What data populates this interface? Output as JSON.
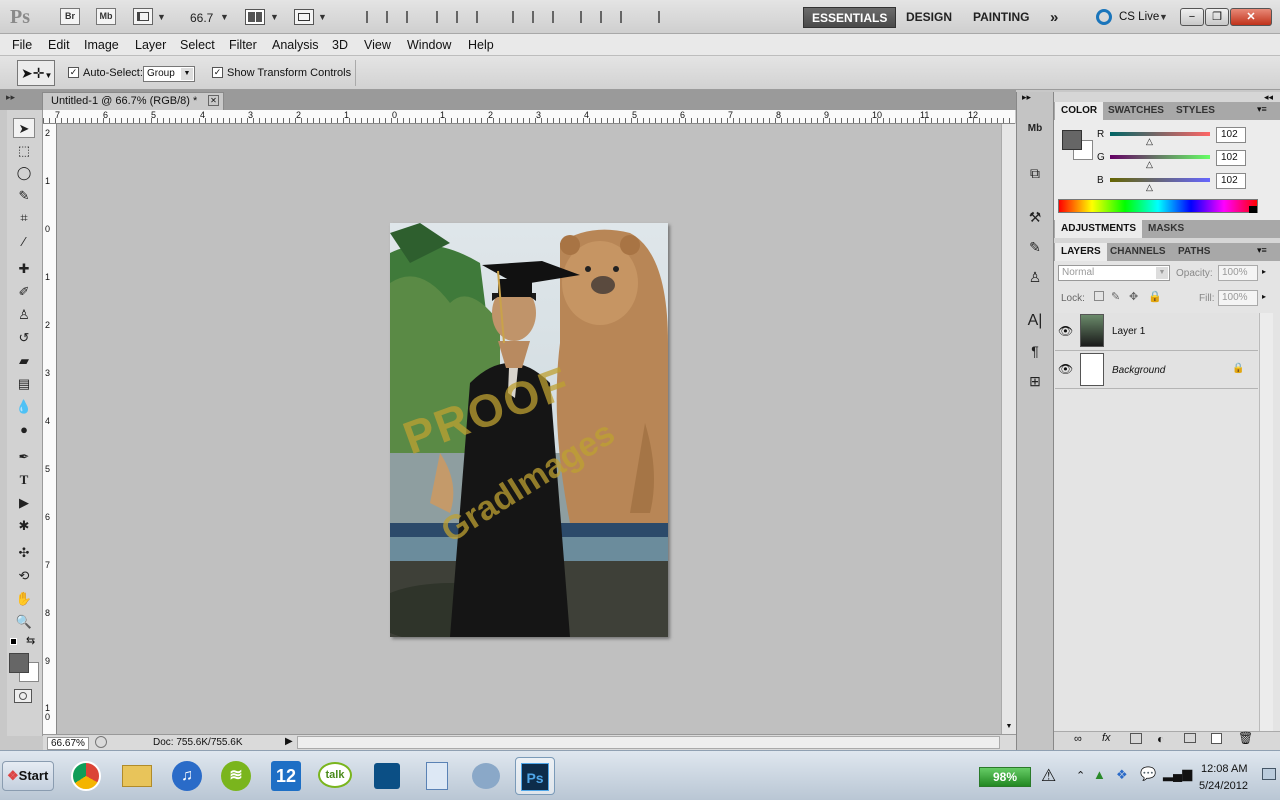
{
  "app": {
    "logo": "Ps",
    "bridge_label": "Br",
    "minibridge_label": "Mb",
    "zoom": "66.7"
  },
  "workspaces": {
    "essentials": "ESSENTIALS",
    "design": "DESIGN",
    "painting": "PAINTING",
    "more": "»",
    "cslive": "CS Live"
  },
  "window_controls": {
    "minimize": "−",
    "restore": "❐",
    "close": "✕"
  },
  "menu": [
    "File",
    "Edit",
    "Image",
    "Layer",
    "Select",
    "Filter",
    "Analysis",
    "3D",
    "View",
    "Window",
    "Help"
  ],
  "options": {
    "auto_select_label": "Auto-Select:",
    "auto_select_value": "Group",
    "transform_label": "Show Transform Controls"
  },
  "document": {
    "tab_title": "Untitled-1 @ 66.7% (RGB/8) *",
    "zoom": "66.67%",
    "doc_size": "Doc: 755.6K/755.6K"
  },
  "ruler_h": [
    "7",
    "6",
    "5",
    "4",
    "3",
    "2",
    "1",
    "0",
    "1",
    "2",
    "3",
    "4",
    "5",
    "6",
    "7",
    "8",
    "9",
    "10",
    "11",
    "12"
  ],
  "ruler_v": [
    "2",
    "1",
    "0",
    "1",
    "2",
    "3",
    "4",
    "5",
    "6",
    "7",
    "8",
    "9",
    "1\n0"
  ],
  "photo": {
    "watermark_1": "PROOF",
    "watermark_2": "GradImages"
  },
  "color_panel": {
    "tabs": [
      "COLOR",
      "SWATCHES",
      "STYLES"
    ],
    "r_label": "R",
    "g_label": "G",
    "b_label": "B",
    "r_value": "102",
    "g_value": "102",
    "b_value": "102",
    "foreground": "#666666"
  },
  "adjust_panel": {
    "tabs": [
      "ADJUSTMENTS",
      "MASKS"
    ]
  },
  "layers_panel": {
    "tabs": [
      "LAYERS",
      "CHANNELS",
      "PATHS"
    ],
    "blend_mode": "Normal",
    "opacity_label": "Opacity:",
    "opacity_value": "100%",
    "lock_label": "Lock:",
    "fill_label": "Fill:",
    "fill_value": "100%",
    "layers": [
      {
        "name": "Layer 1"
      },
      {
        "name": "Background"
      }
    ]
  },
  "taskbar": {
    "start_label": "Start",
    "calendar_day": "12",
    "gtalk": "talk",
    "battery": "98%",
    "time": "12:08 AM",
    "date": "5/24/2012"
  }
}
